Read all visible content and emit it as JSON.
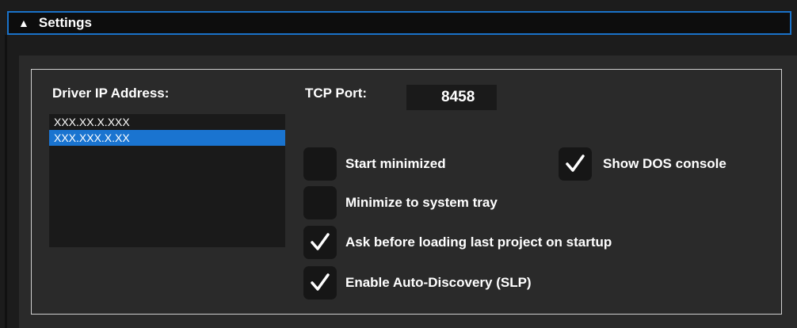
{
  "header": {
    "arrow": "▲",
    "title": "Settings"
  },
  "driver_ip": {
    "label": "Driver IP Address:",
    "items": [
      {
        "text": "XXX.XX.X.XXX",
        "selected": false
      },
      {
        "text": "XXX.XXX.X.XX",
        "selected": true
      }
    ]
  },
  "tcp_port": {
    "label": "TCP Port:",
    "value": "8458"
  },
  "options": {
    "start_minimized": {
      "label": "Start minimized",
      "checked": false
    },
    "show_dos_console": {
      "label": "Show DOS console",
      "checked": true
    },
    "minimize_to_tray": {
      "label": "Minimize to system tray",
      "checked": false
    },
    "ask_before_loading": {
      "label": "Ask before loading last project on startup",
      "checked": true
    },
    "enable_auto_discovery": {
      "label": "Enable Auto-Discovery (SLP)",
      "checked": true
    }
  },
  "colors": {
    "accent": "#1a74d0",
    "header_border": "#1a72c9",
    "background": "#2a2a2a"
  }
}
